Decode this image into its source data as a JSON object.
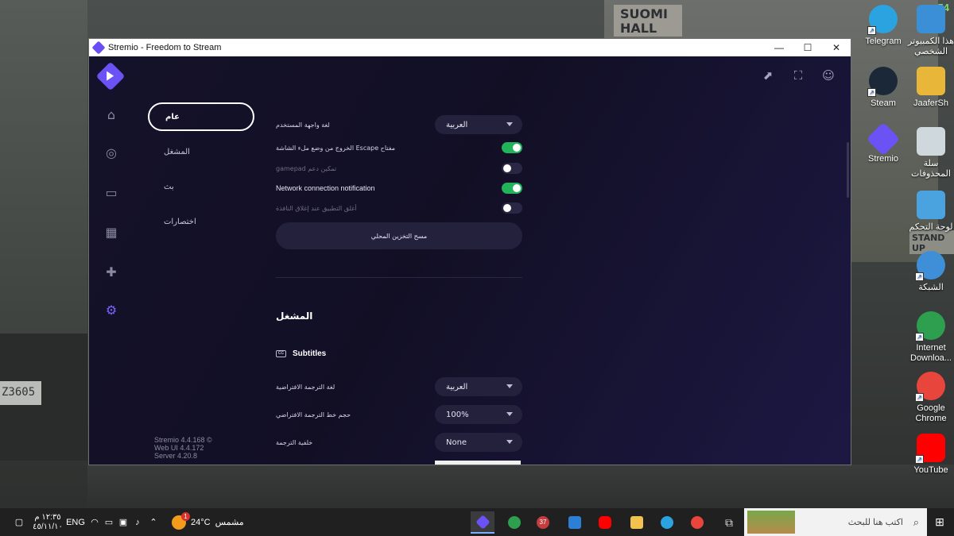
{
  "desktop": {
    "corner_number": "54",
    "scene_sign": "SUOMI HALL",
    "scene_plate": "Z3605",
    "scene_standup": "STAND UP",
    "icons": [
      {
        "label": "Telegram",
        "color": "#2aa3e0"
      },
      {
        "label": "هذا الكمبيوتر الشخصي",
        "color": "#3b8fd6"
      },
      {
        "label": "Steam",
        "color": "#1b2838"
      },
      {
        "label": "JaaferSh",
        "color": "#e8b73a"
      },
      {
        "label": "Stremio",
        "color": "#6b52f4"
      },
      {
        "label": "سلة المحذوفات",
        "color": "#cfd8dc"
      },
      {
        "label": "لوحة التحكم",
        "color": "#4aa3df"
      },
      {
        "label": "الشبكة",
        "color": "#3f8fd8"
      },
      {
        "label": "Internet Downloa...",
        "color": "#2e9e4f"
      },
      {
        "label": "Google Chrome",
        "color": "#e8453c"
      },
      {
        "label": "YouTube",
        "color": "#ff0000"
      }
    ]
  },
  "window": {
    "title": "Stremio - Freedom to Stream",
    "minimize": "—",
    "maximize": "☐",
    "close": "✕"
  },
  "nav": {
    "icons": [
      "home-icon",
      "discover-icon",
      "library-icon",
      "calendar-icon",
      "addons-icon",
      "settings-icon"
    ]
  },
  "header_icons": [
    "external-link-icon",
    "fullscreen-icon",
    "profile-icon"
  ],
  "categories": [
    {
      "label": "عام",
      "active": true
    },
    {
      "label": "المشغل",
      "active": false
    },
    {
      "label": "بث",
      "active": false
    },
    {
      "label": "اختصارات",
      "active": false
    }
  ],
  "version": {
    "app": "Stremio 4.4.168 ©",
    "web": "Web UI 4.4.172",
    "server": "Server 4.20.8"
  },
  "general": {
    "language_label": "لغة واجهة المستخدم",
    "language_value": "العربية",
    "escape_label": "الخروج من وضع ملء الشاشة Escape مفتاح",
    "escape_on": true,
    "gamepad_label": "gamepad تمكين دعم",
    "gamepad_on": false,
    "network_label": "Network connection notification",
    "network_on": true,
    "quit_label": "أغلق التطبيق عند إغلاق النافذة",
    "quit_on": false,
    "clear_storage_label": "مسح التخزين المحلي"
  },
  "player": {
    "section_title": "المشغل",
    "subtitles_title": "Subtitles",
    "cc_badge": "CC",
    "sub_lang_label": "لغة الترجمة الافتراضية",
    "sub_lang_value": "العربية",
    "sub_size_label": "حجم خط الترجمة الافتراضي",
    "sub_size_value": "100%",
    "sub_bg_label": "خلفية الترجمة",
    "sub_bg_value": "None"
  },
  "taskbar": {
    "search_placeholder": "اكتب هنا للبحث",
    "weather_temp": "24°C",
    "weather_text": "مشمس",
    "weather_badge": "1",
    "language": "ENG",
    "time": "١٢:٣٥ م",
    "date": "٤٥/١١/١٠",
    "app_badge": "37",
    "apps": [
      {
        "name": "stremio",
        "color": "#6b52f4",
        "active": true
      },
      {
        "name": "internet-download-manager",
        "color": "#2e9e4f",
        "active": false
      },
      {
        "name": "app-badge",
        "color": "#c43d3d",
        "active": false
      },
      {
        "name": "mail",
        "color": "#2d7fd3",
        "active": false
      },
      {
        "name": "youtube",
        "color": "#ff0000",
        "active": false
      },
      {
        "name": "file-explorer",
        "color": "#f2c14e",
        "active": false
      },
      {
        "name": "telegram",
        "color": "#2aa3e0",
        "active": false
      },
      {
        "name": "chrome",
        "color": "#e8453c",
        "active": false
      },
      {
        "name": "task-view",
        "color": "#bdbdbd",
        "active": false
      }
    ]
  }
}
